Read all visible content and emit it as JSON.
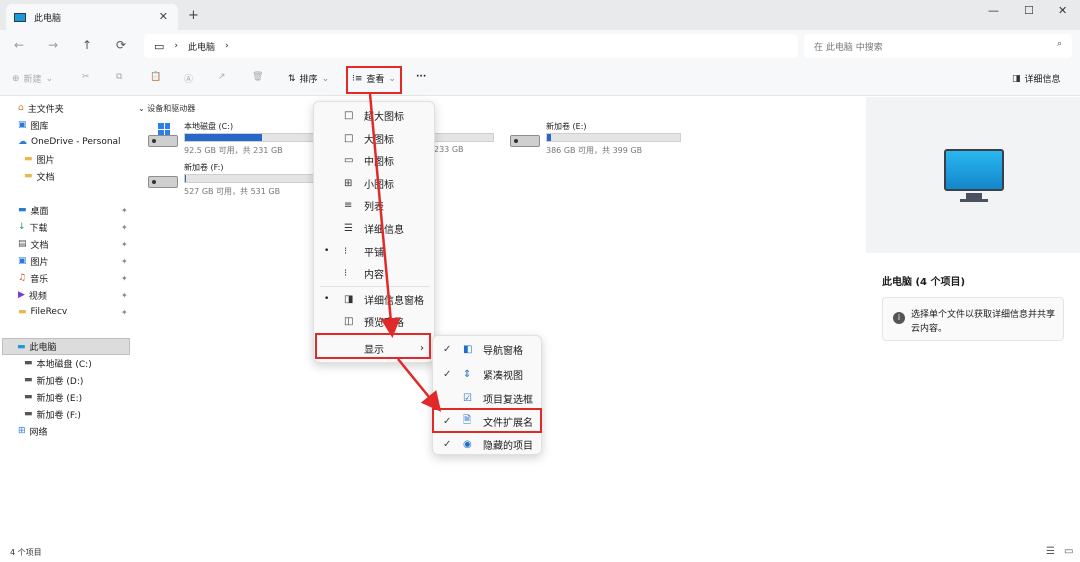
{
  "window": {
    "tab_title": "此电脑",
    "tab_close": "✕",
    "new_tab": "+",
    "minimize": "—",
    "maximize": "☐",
    "close": "✕"
  },
  "nav": {
    "back": "←",
    "forward": "→",
    "up": "↑",
    "refresh": "⟳",
    "address_root_icon": "▭",
    "breadcrumb_sep": "›",
    "breadcrumb": "此电脑",
    "breadcrumb_chevron": "›",
    "search_placeholder": "在 此电脑 中搜索",
    "search_icon": "⌕"
  },
  "toolbar": {
    "new_label": "新建",
    "sort_label": "排序",
    "view_label": "查看",
    "more_label": "···",
    "details_label": "详细信息"
  },
  "sidebar": {
    "items": [
      {
        "label": "主文件夹",
        "icon": "home-icon"
      },
      {
        "label": "图库",
        "icon": "gallery-icon"
      },
      {
        "label": "OneDrive - Personal",
        "icon": "cloud-icon"
      },
      {
        "label": "图片",
        "icon": "folder-icon"
      },
      {
        "label": "文档",
        "icon": "folder-icon"
      },
      {
        "label": "桌面",
        "icon": "desktop-icon"
      },
      {
        "label": "下载",
        "icon": "download-icon"
      },
      {
        "label": "文档",
        "icon": "document-icon"
      },
      {
        "label": "图片",
        "icon": "picture-icon"
      },
      {
        "label": "音乐",
        "icon": "music-icon"
      },
      {
        "label": "视频",
        "icon": "video-icon"
      },
      {
        "label": "FileRecv",
        "icon": "folder-icon"
      },
      {
        "label": "此电脑",
        "icon": "computer-icon"
      },
      {
        "label": "本地磁盘 (C:)",
        "icon": "drive-icon"
      },
      {
        "label": "新加卷 (D:)",
        "icon": "drive-icon"
      },
      {
        "label": "新加卷 (E:)",
        "icon": "drive-icon"
      },
      {
        "label": "新加卷 (F:)",
        "icon": "drive-icon"
      },
      {
        "label": "网络",
        "icon": "network-icon"
      }
    ]
  },
  "content": {
    "section_title": "设备和驱动器",
    "drives": [
      {
        "name": "本地磁盘 (C:)",
        "info": "92.5 GB 可用，共 231 GB",
        "used_fraction": 0.6
      },
      {
        "name": "",
        "info": "233 GB",
        "used_fraction": 0.1
      },
      {
        "name": "新加卷 (E:)",
        "info": "386 GB 可用，共 399 GB",
        "used_fraction": 0.03
      },
      {
        "name": "新加卷 (F:)",
        "info": "527 GB 可用，共 531 GB",
        "used_fraction": 0.01
      }
    ]
  },
  "view_menu": {
    "items": [
      {
        "label": "超大图标",
        "icon": "□"
      },
      {
        "label": "大图标",
        "icon": "□"
      },
      {
        "label": "中图标",
        "icon": "▭"
      },
      {
        "label": "小图标",
        "icon": "⊞"
      },
      {
        "label": "列表",
        "icon": "≡"
      },
      {
        "label": "详细信息",
        "icon": "☰"
      },
      {
        "label": "平铺",
        "icon": "⁝",
        "bullet": "•"
      },
      {
        "label": "内容",
        "icon": "⁝"
      },
      {
        "label": "详细信息窗格",
        "icon": "◨",
        "bullet": "•"
      },
      {
        "label": "预览窗格",
        "icon": "◫"
      },
      {
        "label": "显示",
        "arrow": "›"
      }
    ]
  },
  "show_submenu": {
    "items": [
      {
        "label": "导航窗格",
        "check": "✓",
        "icon": "◧"
      },
      {
        "label": "紧凑视图",
        "check": "✓",
        "icon": "⇕"
      },
      {
        "label": "项目复选框",
        "check": "",
        "icon": "☑"
      },
      {
        "label": "文件扩展名",
        "check": "✓",
        "icon": "🗎"
      },
      {
        "label": "隐藏的项目",
        "check": "✓",
        "icon": "◉"
      }
    ]
  },
  "details_pane": {
    "title": "此电脑 (4 个项目)",
    "info_icon": "i",
    "info_text": "选择单个文件以获取详细信息并共享云内容。"
  },
  "status": {
    "item_count": "4 个项目"
  },
  "colors": {
    "accent": "#2667c9",
    "highlight_red": "#e02a2a"
  }
}
